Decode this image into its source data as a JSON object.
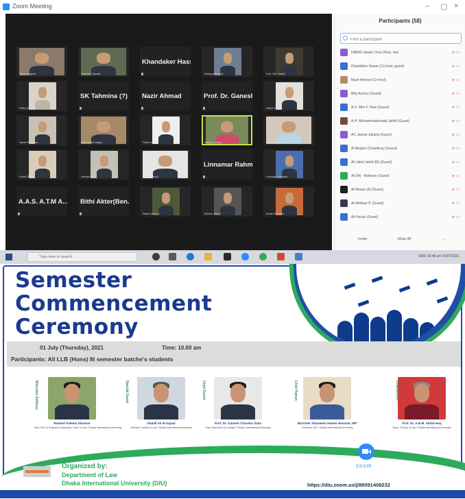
{
  "window": {
    "title": "Zoom Meeting",
    "controls": [
      "–",
      "▢",
      "×"
    ]
  },
  "gallery": {
    "name_tiles": [
      "Khandaker Hass...",
      "SK Tahmina (?)",
      "Nazir Ahmad",
      "Prof. Dr. Ganesh...",
      "Linnamar Rahma...",
      "A.A.S. A.T.M A...",
      "Bithi Akter(Ben..."
    ],
    "tile_labels": [
      "Tahsina Iqbal",
      "Sabinaa Yasmin",
      "Rokeya Begum",
      "Prof. Md. Habib",
      "Rafiq Hossain",
      "Abdul Kadir",
      "Tanvir Rahman",
      "Mahmudul Haque",
      "Sakib Islam",
      "Nayeem Khan",
      "Farhana Akter",
      "Sohel Rana",
      "Jannat Ara",
      "Arif Mahmud",
      "Sumaiya Hossain",
      "Rasel Ahmed",
      "Nusrat Jahan",
      "Imran Hossain"
    ]
  },
  "participants": {
    "title": "Participants (58)",
    "search_placeholder": "Find a participant",
    "items": [
      {
        "name": "DIBMS Islamic Host (Host, me)",
        "color": "#8a5cd6"
      },
      {
        "name": "Khandaker Hasan (Co-host, guest)",
        "color": "#3b6fd1"
      },
      {
        "name": "Nazir Ahmad (Co-host)",
        "color": "#b88a6a"
      },
      {
        "name": "Billy Antony (Guest)",
        "color": "#8a5cd6"
      },
      {
        "name": "A.S. Mim F. Ham (Guest)",
        "color": "#3b6fd1"
      },
      {
        "name": "A.H. Mohammadunnabi Jahidi (Guest)",
        "color": "#7a4a3a"
      },
      {
        "name": "AC Jannat Jakaria (Guest)",
        "color": "#8a5cd6"
      },
      {
        "name": "Al Mujahir Chowdhury (Guest)",
        "color": "#3b6fd1"
      },
      {
        "name": "Ali Jabid Jahid (M) (Guest)",
        "color": "#3b6fd1"
      },
      {
        "name": "Ali (M) - Rahman (Guest)",
        "color": "#2eaa5b"
      },
      {
        "name": "Ali Akram (A) (Guest)",
        "color": "#222222"
      },
      {
        "name": "Ali Akhtaar P. (Guest)",
        "color": "#333a4a"
      },
      {
        "name": "Ali Hasan (Guest)",
        "color": "#3b6fd1"
      }
    ],
    "invite_label": "Invite",
    "mute_all_label": "Mute All",
    "more_label": "..."
  },
  "taskbar": {
    "search_placeholder": "Type here to search",
    "tray_text": "ENG  10:48 am  01/07/2021"
  },
  "poster": {
    "title_lines": [
      "Semester",
      "Commencement",
      "Ceremony"
    ],
    "date": "01 July (Thursday), 2021",
    "time": "Time: 10.00 am",
    "participants": "Participants: All LLB (Hons) 8t semester batche's students",
    "guests": [
      {
        "role": "Welcome Address",
        "name": "Rashed Saleem Sharwar",
        "desc": "Asst. Prof. & Program Coordinator, Dept. of Law / Dhaka International University"
      },
      {
        "role": "Special Guest",
        "name": "Obaidl Ali M Sujaul",
        "desc": "Member, Faculty of Law / Dhaka International University"
      },
      {
        "role": "Chief Guest",
        "name": "Prof. Dr. Ganesh Chandra Saha",
        "desc": "Vice-Chancellor (In-charge) / Dhaka International University"
      },
      {
        "role": "Chief Patron",
        "name": "Barrister Shameem Haider Hossain, MP",
        "desc": "Chairman, BoT / Dhaka International University"
      },
      {
        "role": "Chairperson",
        "name": "Prof. Dr. A.B.M. Abdul Haq",
        "desc": "Dean, Faculty of Law / Dhaka International University"
      }
    ],
    "organized_by": "Organized by:",
    "department": "Department of Law",
    "university": "Dhaka International University (DIU)",
    "zoom_word": "zoom",
    "zoom_link": "https://diu.zoom.us/j/88091408232"
  }
}
